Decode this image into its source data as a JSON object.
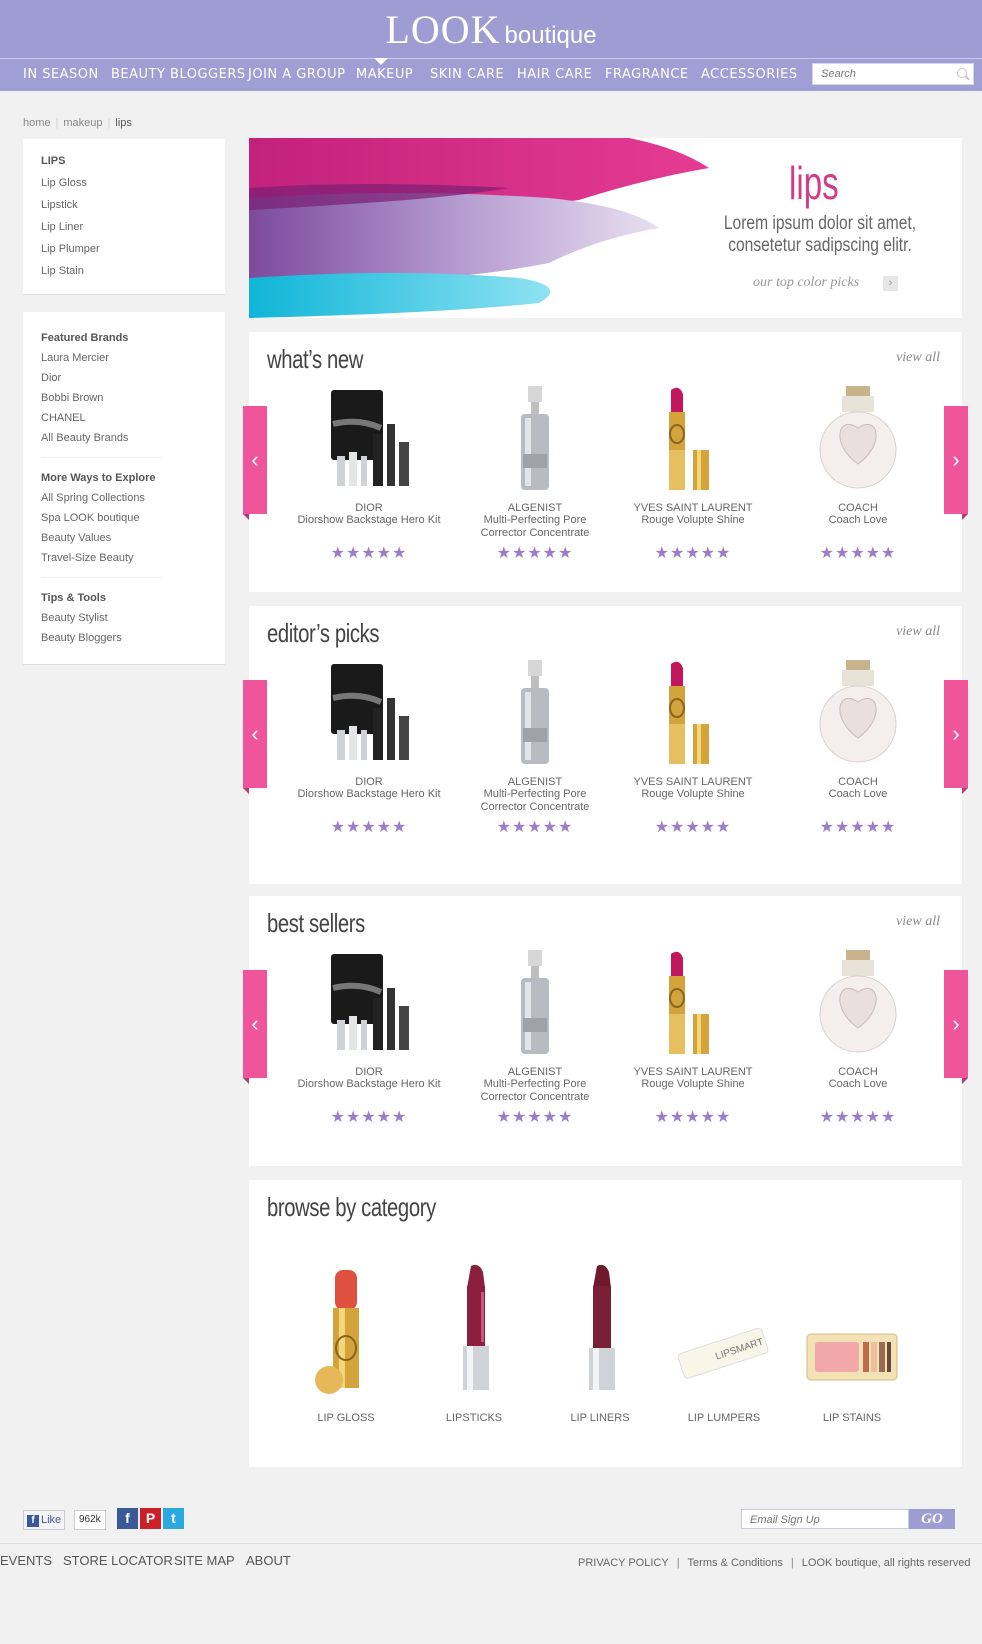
{
  "brand": {
    "logo_main": "LOOK",
    "logo_sub": "boutique"
  },
  "nav": {
    "items": [
      "IN SEASON",
      "BEAUTY BLOGGERS",
      "JOIN A GROUP",
      "MAKEUP",
      "SKIN CARE",
      "HAIR CARE",
      "FRAGRANCE",
      "ACCESSORIES"
    ],
    "active": "MAKEUP",
    "search_placeholder": "Search"
  },
  "breadcrumb": {
    "items": [
      "home",
      "makeup",
      "lips"
    ]
  },
  "sidebar": {
    "section1": {
      "title": "LIPS",
      "links": [
        "Lip Gloss",
        "Lipstick",
        "Lip Liner",
        "Lip Plumper",
        "Lip Stain"
      ]
    },
    "section2": {
      "title": "Featured Brands",
      "links": [
        "Laura Mercier",
        "Dior",
        "Bobbi Brown",
        "CHANEL",
        "All Beauty Brands"
      ]
    },
    "section3": {
      "title": "More Ways to Explore",
      "links": [
        "All Spring Collections",
        "Spa LOOK boutique",
        "Beauty Values",
        "Travel-Size Beauty"
      ]
    },
    "section4": {
      "title": "Tips & Tools",
      "links": [
        "Beauty Stylist",
        "Beauty Bloggers"
      ]
    }
  },
  "hero": {
    "title": "lips",
    "text": "Lorem ipsum dolor sit amet, consetetur sadipscing elitr.",
    "link": "our top color picks",
    "arrow": "›"
  },
  "product_sections": [
    {
      "title": "what’s new",
      "view_all": "view all"
    },
    {
      "title": "editor’s picks",
      "view_all": "view all"
    },
    {
      "title": "best sellers",
      "view_all": "view all"
    }
  ],
  "products": [
    {
      "brand": "DIOR",
      "name": "Diorshow Backstage Hero Kit",
      "rating": 5,
      "stars": "★★★★★",
      "icon": "makeup-kit-icon"
    },
    {
      "brand": "ALGENIST",
      "name": "Multi-Perfecting Pore Corrector Concentrate",
      "rating": 5,
      "stars": "★★★★★",
      "icon": "serum-bottle-icon"
    },
    {
      "brand": "Yves SAINT LAURENT",
      "name": "Rouge Volupte Shine",
      "rating": 5,
      "stars": "★★★★★",
      "icon": "lipstick-icon"
    },
    {
      "brand": "COACH",
      "name": "Coach Love",
      "rating": 5,
      "stars": "★★★★★",
      "icon": "perfume-bottle-icon"
    }
  ],
  "arrows": {
    "left": "‹",
    "right": "›"
  },
  "category": {
    "title": "browse by category",
    "items": [
      "LIP GLOSS",
      "LIPSTICKS",
      "LIP LINERS",
      "LIP LUMPERS",
      "LIP STAINS"
    ],
    "tube_text": "LIPSMART"
  },
  "footer": {
    "fb_like": "Like",
    "fb_count": "962k",
    "social": [
      "f",
      "P",
      "t"
    ],
    "email_placeholder": "Email Sign Up",
    "go": "GO",
    "links": [
      "EVENTS",
      "STORE LOCATOR",
      "SITE MAP",
      "ABOUT"
    ],
    "legal": [
      "PRIVACY POLICY",
      "Terms & Conditions",
      "LOOK boutique, all rights reserved"
    ]
  },
  "colors": {
    "header": "#9d9dd3",
    "accent_pink": "#f0559c",
    "star": "#9a7ec9",
    "hero_title": "#d03c86"
  }
}
